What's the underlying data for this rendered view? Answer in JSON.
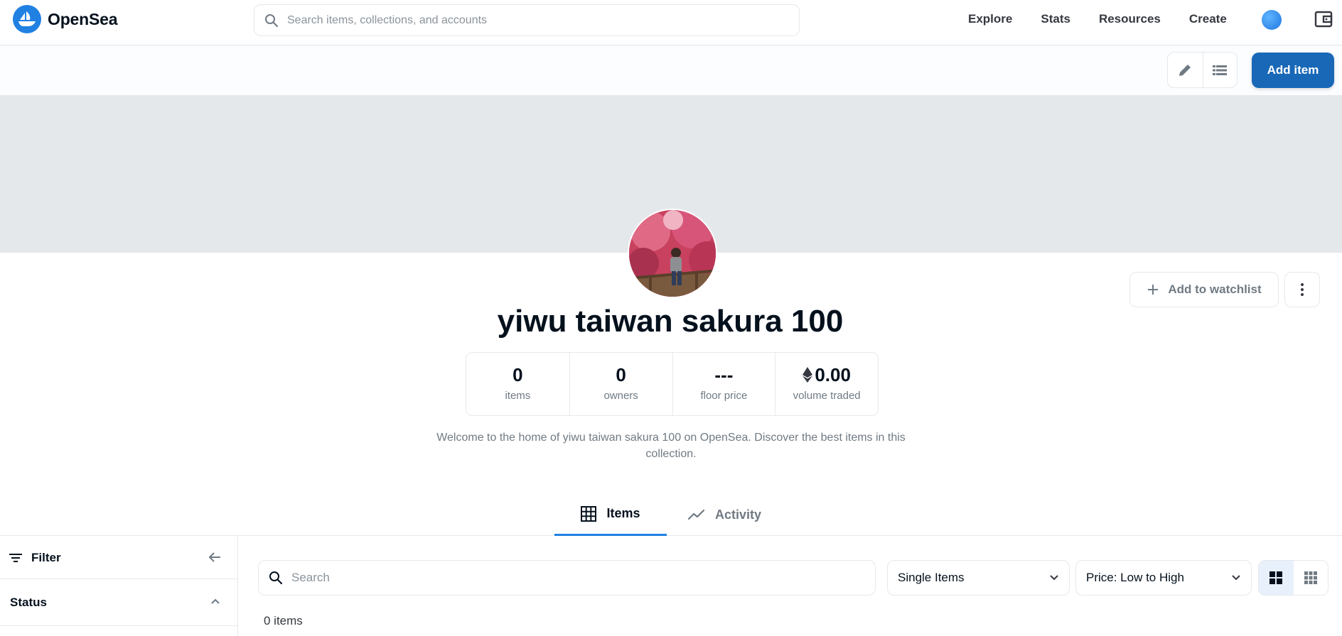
{
  "nav": {
    "brand": "OpenSea",
    "search_placeholder": "Search items, collections, and accounts",
    "links": [
      "Explore",
      "Stats",
      "Resources",
      "Create"
    ],
    "brand_color": "#2081e2"
  },
  "toolbar": {
    "edit_icon": "pencil-icon",
    "list_icon": "list-icon",
    "add_item_label": "Add item"
  },
  "collection": {
    "title": "yiwu taiwan sakura 100",
    "watchlist_label": "Add to watchlist",
    "stats": [
      {
        "value": "0",
        "label": "items"
      },
      {
        "value": "0",
        "label": "owners"
      },
      {
        "value": "---",
        "label": "floor price"
      },
      {
        "value": "0.00",
        "label": "volume traded",
        "icon": "ethereum-icon"
      }
    ],
    "description": "Welcome to the home of yiwu taiwan sakura 100 on OpenSea. Discover the best items in this collection."
  },
  "tabs": [
    {
      "label": "Items",
      "icon": "grid-icon",
      "active": true
    },
    {
      "label": "Activity",
      "icon": "trend-icon",
      "active": false
    }
  ],
  "sidebar": {
    "filter_label": "Filter",
    "status_label": "Status"
  },
  "listing": {
    "search_placeholder": "Search",
    "type_select": "Single Items",
    "sort_select": "Price: Low to High",
    "count_text": "0 items"
  }
}
